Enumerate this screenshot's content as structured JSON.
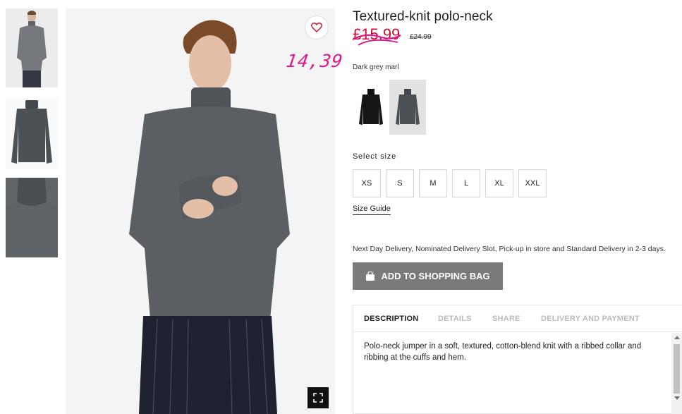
{
  "product": {
    "title": "Textured-knit polo-neck",
    "sale_price": "£15.99",
    "old_price": "£24.99",
    "handwritten_price": "14,39",
    "color_name": "Dark grey marl",
    "favorite_icon": "heart-icon",
    "fullscreen_icon": "expand-icon"
  },
  "colors": [
    {
      "name": "Black",
      "hex": "#111111"
    },
    {
      "name": "Dark grey marl",
      "hex": "#4e555b"
    }
  ],
  "sizes": {
    "label": "Select size",
    "options": [
      "XS",
      "S",
      "M",
      "L",
      "XL",
      "XXL"
    ],
    "guide_label": "Size Guide"
  },
  "delivery_text": "Next Day Delivery, Nominated Delivery Slot, Pick-up in store and Standard Delivery in 2-3 days.",
  "add_to_bag": {
    "label": "ADD TO SHOPPING BAG",
    "icon": "shopping-bag-icon"
  },
  "tabs": [
    {
      "label": "DESCRIPTION"
    },
    {
      "label": "DETAILS"
    },
    {
      "label": "SHARE"
    },
    {
      "label": "DELIVERY AND PAYMENT"
    }
  ],
  "description": "Polo-neck jumper in a soft, textured, cotton-blend knit with a ribbed collar and ribbing at the cuffs and hem.",
  "theme": {
    "sale_color": "#c8102e",
    "annotation_color": "#e0178b",
    "button_color": "#7a7a7a"
  }
}
